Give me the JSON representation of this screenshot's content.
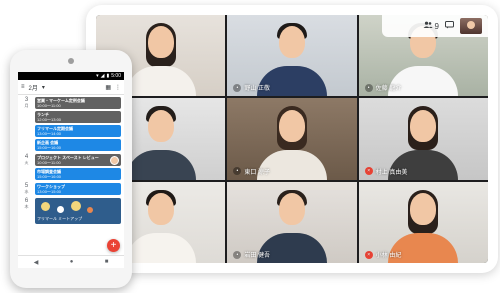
{
  "meet": {
    "topbar": {
      "participants_count": "9"
    },
    "tiles": [
      {
        "name": ""
      },
      {
        "name": "野山 正敬"
      },
      {
        "name": "佐藤 龍介"
      },
      {
        "name": ""
      },
      {
        "name": "東口 涼子"
      },
      {
        "name": "村上 真由美"
      },
      {
        "name": ""
      },
      {
        "name": "岩田 健吾"
      },
      {
        "name": "小林 由紀"
      }
    ]
  },
  "phone": {
    "status": {
      "time": "5:00"
    },
    "app_bar": {
      "menu_icon": "≡",
      "month": "2月",
      "dropdown": "▾",
      "calendar_icon": "▦",
      "more_icon": "⋮"
    },
    "days": [
      {
        "num": "3",
        "name": "月",
        "events": [
          {
            "title": "営業・マーケーム定例会議",
            "time": "10:00〜11:00",
            "color": "#616161"
          },
          {
            "title": "ランチ",
            "time": "12:00〜13:00",
            "color": "#616161"
          },
          {
            "title": "フリマール定期会議",
            "time": "13:00〜14:00",
            "color": "#1e88e5"
          },
          {
            "title": "新企画 会議",
            "time": "15:00〜16:00",
            "color": "#1e88e5"
          }
        ]
      },
      {
        "num": "4",
        "name": "火",
        "events": [
          {
            "title": "プロジェクト スペースト レビュー",
            "time": "10:00〜11:00",
            "color": "#616161",
            "avatar": true
          },
          {
            "title": "市場調査会議",
            "time": "15:00〜16:00",
            "color": "#1e88e5"
          }
        ]
      },
      {
        "num": "5",
        "name": "水",
        "events": [
          {
            "title": "ワークショップ",
            "time": "13:00〜15:00",
            "color": "#1e88e5"
          }
        ]
      },
      {
        "num": "6",
        "name": "木",
        "image_event": {
          "caption": "フリマール ミートアップ"
        }
      }
    ],
    "fab_label": "+",
    "nav": {
      "back": "◀",
      "home": "●",
      "recent": "■"
    }
  }
}
